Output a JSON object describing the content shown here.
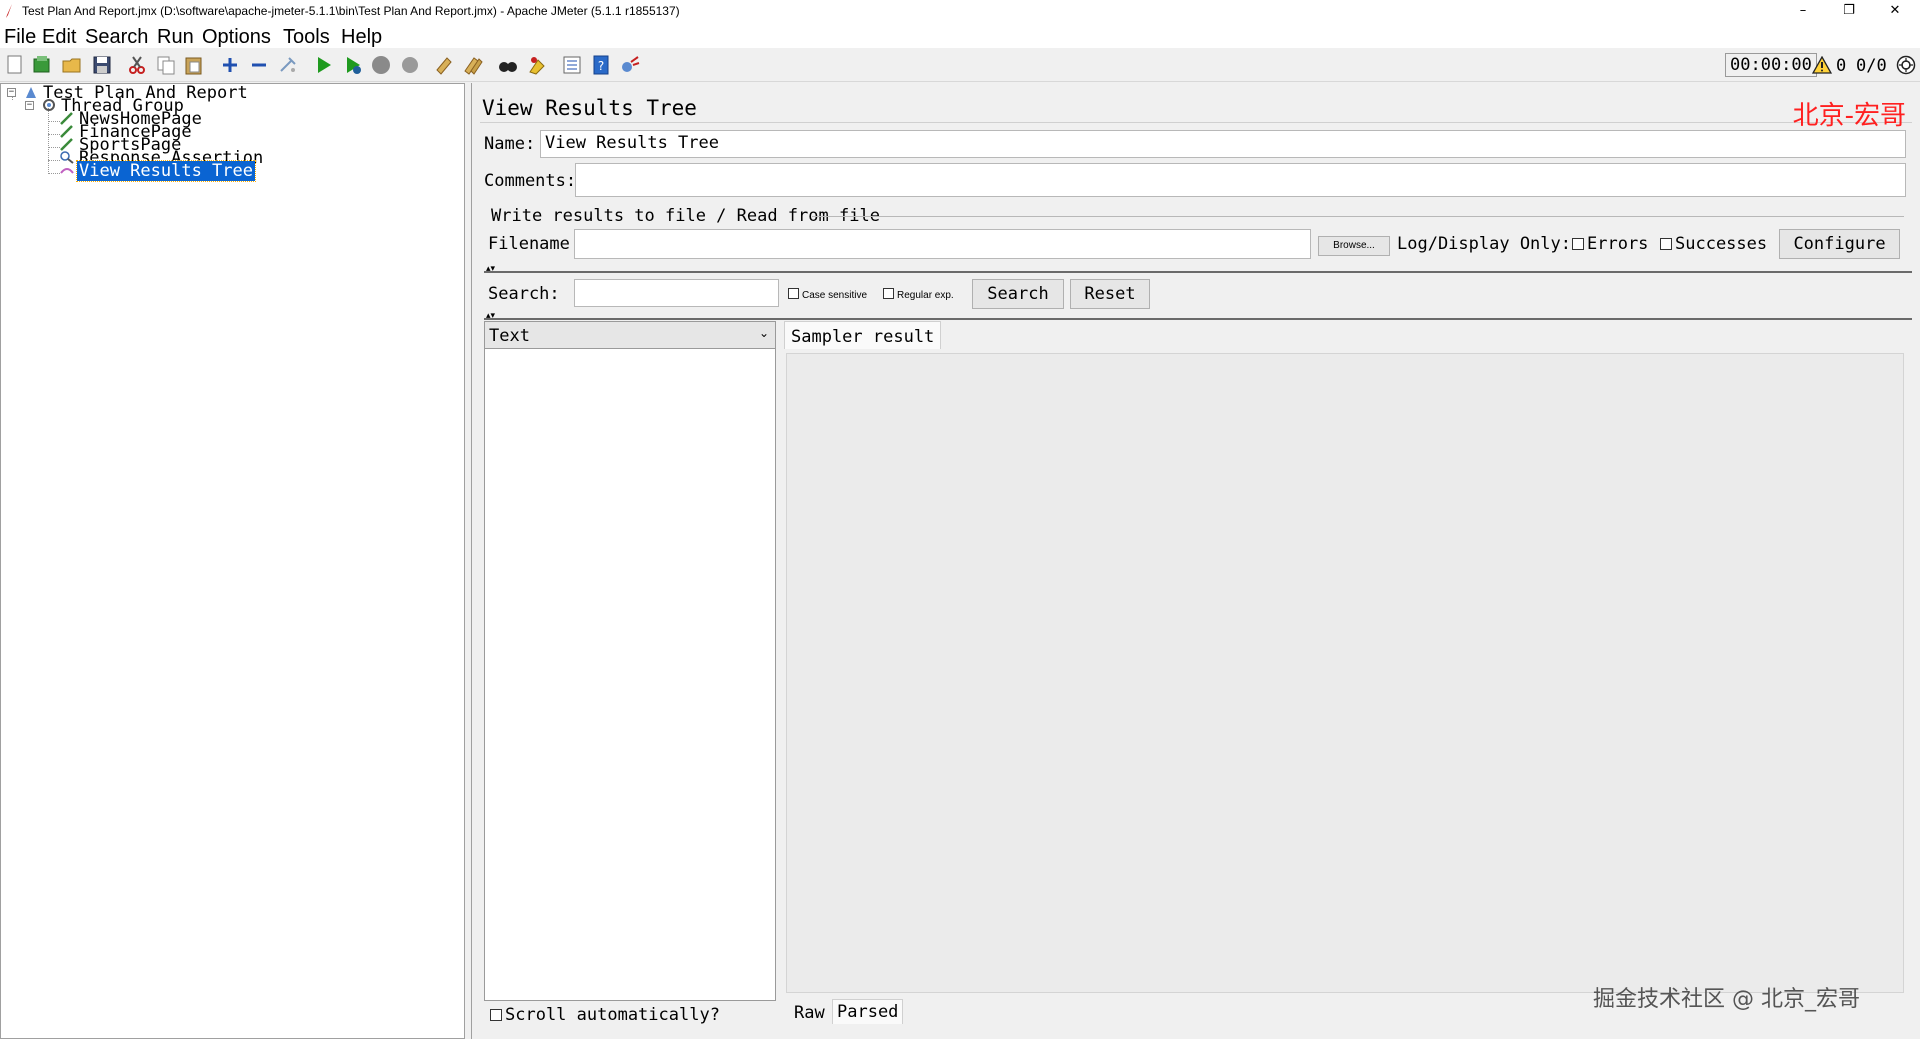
{
  "window": {
    "title": "Test Plan And Report.jmx (D:\\software\\apache-jmeter-5.1.1\\bin\\Test Plan And Report.jmx) - Apache JMeter (5.1.1 r1855137)",
    "minimize": "–",
    "maximize": "❐",
    "close": "✕"
  },
  "menu": {
    "file": "File",
    "edit": "Edit",
    "search": "Search",
    "run": "Run",
    "options": "Options",
    "tools": "Tools",
    "help": "Help"
  },
  "toolbar": {
    "timer": "00:00:00",
    "error_count": "0",
    "thread_count": "0/0",
    "icons": [
      "new-icon",
      "templates-icon",
      "open-icon",
      "save-icon",
      "cut-icon",
      "copy-icon",
      "paste-icon",
      "expand-icon",
      "collapse-icon",
      "toggle-icon",
      "start-icon",
      "start-no-pauses-icon",
      "stop-icon",
      "shutdown-icon",
      "clear-icon",
      "clear-all-icon",
      "search-icon",
      "reset-search-icon",
      "function-helper-icon",
      "help-icon",
      "remote-icon"
    ]
  },
  "tree": {
    "root": "Test Plan And Report",
    "thread_group": "Thread Group",
    "children": [
      "NewsHomePage",
      "FinancePage",
      "SportsPage",
      "Response Assertion",
      "View Results Tree"
    ]
  },
  "panel": {
    "title": "View Results Tree",
    "watermark_top": "北京-宏哥",
    "name_label": "Name:",
    "name_value": "View Results Tree",
    "comments_label": "Comments:",
    "comments_value": "",
    "file_section": "Write results to file / Read from file",
    "filename_label": "Filename",
    "filename_value": "",
    "browse": "Browse...",
    "log_display": "Log/Display Only:",
    "errors": "Errors",
    "successes": "Successes",
    "configure": "Configure",
    "search_label": "Search:",
    "search_value": "",
    "case_sensitive": "Case sensitive",
    "regular_exp": "Regular exp.",
    "search_btn": "Search",
    "reset_btn": "Reset",
    "renderer": "Text",
    "scroll_auto": "Scroll automatically?",
    "tab_sampler": "Sampler result",
    "tab_raw": "Raw",
    "tab_parsed": "Parsed",
    "watermark_bottom": "掘金技术社区 @ 北京_宏哥"
  },
  "colors": {
    "selection": "#0a64d2",
    "watermark_red": "#ff2020"
  }
}
